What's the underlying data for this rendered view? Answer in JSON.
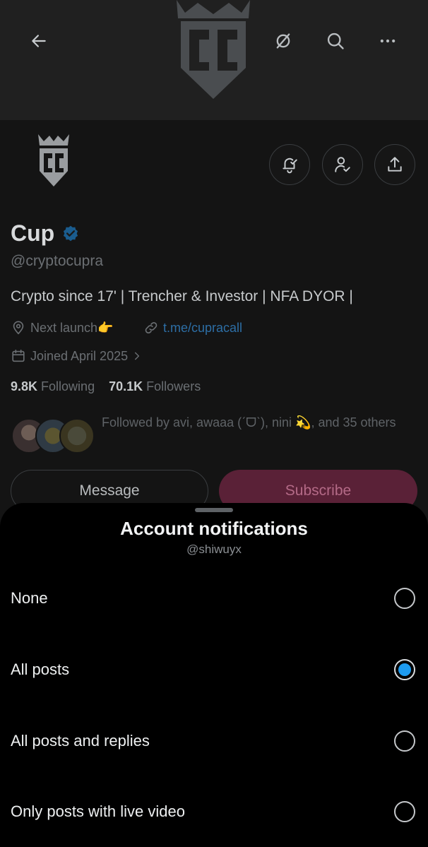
{
  "profile": {
    "name": "Cup",
    "handle": "@cryptocupra",
    "bio": "Crypto since 17' | Trencher & Investor | NFA DYOR |",
    "location": "Next launch👉",
    "website": "t.me/cupracall",
    "joined": "Joined April 2025",
    "following_count": "9.8K",
    "following_label": "Following",
    "followers_count": "70.1K",
    "followers_label": "Followers",
    "followed_by": "Followed by avi, awaaa (ˊᗜˋ), nini 💫, and 35 others",
    "message_label": "Message",
    "subscribe_label": "Subscribe",
    "logo_letters": "CC"
  },
  "icons": {
    "back": "back-arrow-icon",
    "grok": "grok-icon",
    "search": "search-icon",
    "more": "more-icon",
    "notify": "bell-icon",
    "follow": "user-check-icon",
    "share": "share-icon",
    "verified": "verified-badge-icon"
  },
  "colors": {
    "accent": "#1d9bf0",
    "subscribe_bg": "#5a2137",
    "sheet_bg": "#000000"
  },
  "sheet": {
    "title": "Account notifications",
    "subtitle": "@shiwuyx",
    "options": [
      {
        "label": "None",
        "selected": false
      },
      {
        "label": "All posts",
        "selected": true
      },
      {
        "label": "All posts and replies",
        "selected": false
      },
      {
        "label": "Only posts with live video",
        "selected": false
      }
    ]
  }
}
